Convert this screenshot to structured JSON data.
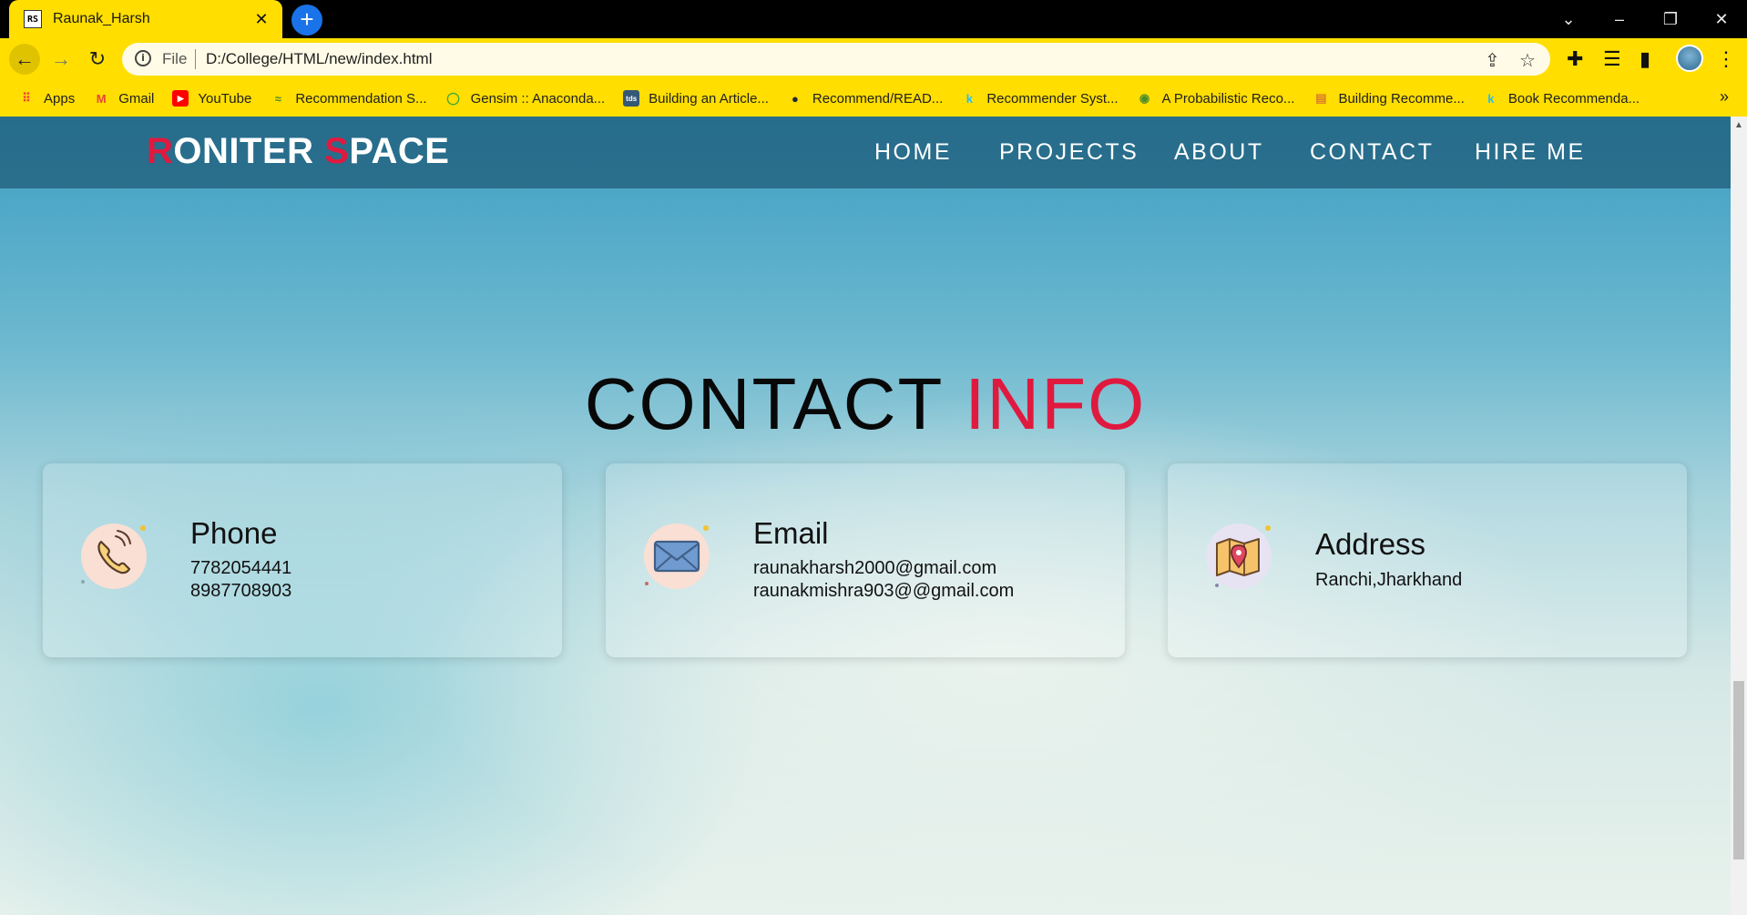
{
  "browser": {
    "tab_title": "Raunak_Harsh",
    "tab_favicon_text": "RS",
    "address_scheme": "File",
    "address_url": "D:/College/HTML/new/index.html",
    "bookmarks": [
      {
        "label": "Apps",
        "icon": "apps-grid-icon",
        "color": "#ea4335"
      },
      {
        "label": "Gmail",
        "icon": "gmail-icon",
        "color": "#ea4335"
      },
      {
        "label": "YouTube",
        "icon": "youtube-icon",
        "color": "#ff0000"
      },
      {
        "label": "Recommendation S...",
        "icon": "gensim-icon",
        "color": "#4a8c2a"
      },
      {
        "label": "Gensim :: Anaconda...",
        "icon": "anaconda-icon",
        "color": "#44a833"
      },
      {
        "label": "Building an Article...",
        "icon": "tds-icon",
        "color": "#355876"
      },
      {
        "label": "Recommend/READ...",
        "icon": "github-icon",
        "color": "#24292e"
      },
      {
        "label": "Recommender Syst...",
        "icon": "kaggle-icon",
        "color": "#20beff"
      },
      {
        "label": "A Probabilistic Reco...",
        "icon": "eye-icon",
        "color": "#4a8c2a"
      },
      {
        "label": "Building Recomme...",
        "icon": "book-icon",
        "color": "#d97b2b"
      },
      {
        "label": "Book Recommenda...",
        "icon": "kaggle-icon",
        "color": "#20beff"
      }
    ]
  },
  "site": {
    "logo": {
      "first_initial": "R",
      "first_rest": "ONITER ",
      "second_initial": "S",
      "second_rest": "PACE"
    },
    "nav": [
      "HOME",
      "PROJECTS",
      "ABOUT",
      "CONTACT",
      "HIRE ME"
    ],
    "heading": {
      "part1": "CONTACT",
      "part2": "INFO"
    },
    "colors": {
      "accent": "#e0193f",
      "header": "#1e5a76",
      "browser_chrome": "#ffde00"
    },
    "cards": [
      {
        "title": "Phone",
        "lines": [
          "7782054441",
          "8987708903"
        ],
        "icon": "phone-icon"
      },
      {
        "title": "Email",
        "lines": [
          "raunakharsh2000@gmail.com",
          "raunakmishra903@@gmail.com"
        ],
        "icon": "envelope-icon"
      },
      {
        "title": "Address",
        "lines": [
          "Ranchi,Jharkhand"
        ],
        "icon": "map-pin-icon"
      }
    ]
  }
}
